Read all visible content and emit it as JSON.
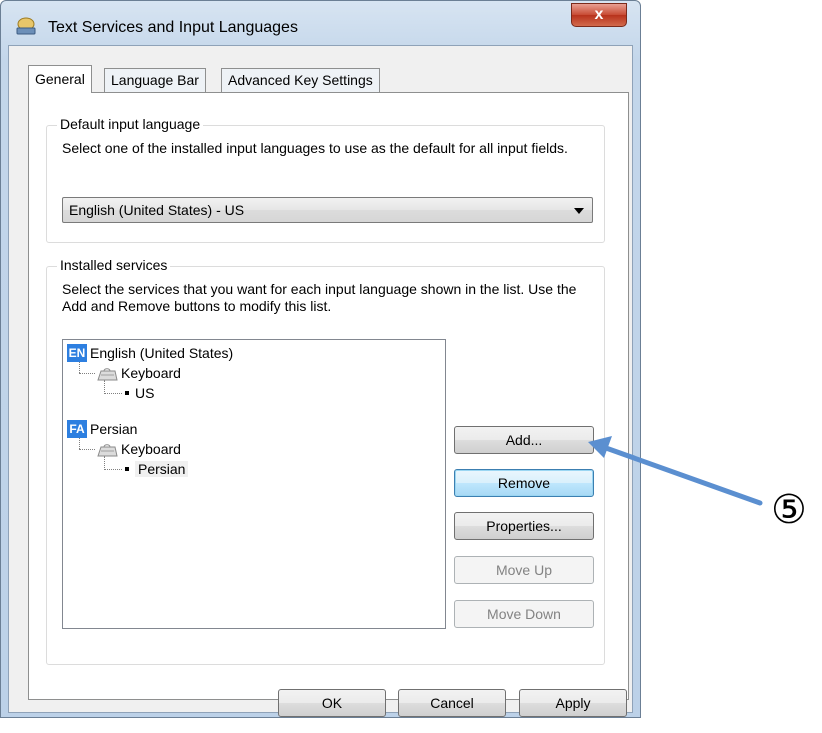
{
  "window": {
    "title": "Text Services and Input Languages",
    "close_glyph": "x"
  },
  "tabs": [
    {
      "label": "General",
      "active": true
    },
    {
      "label": "Language Bar",
      "active": false
    },
    {
      "label": "Advanced Key Settings",
      "active": false
    }
  ],
  "default_input": {
    "legend": "Default input language",
    "description": "Select one of the installed input languages to use as the default for all input fields.",
    "selected": "English (United States) - US"
  },
  "installed_services": {
    "legend": "Installed services",
    "description": "Select the services that you want for each input language shown in the list. Use the Add and Remove buttons to modify this list.",
    "tree": [
      {
        "badge": "EN",
        "language": "English (United States)",
        "category": "Keyboard",
        "layout": "US"
      },
      {
        "badge": "FA",
        "language": "Persian",
        "category": "Keyboard",
        "layout": "Persian"
      }
    ],
    "buttons": {
      "add": "Add...",
      "remove": "Remove",
      "properties": "Properties...",
      "move_up": "Move Up",
      "move_down": "Move Down"
    }
  },
  "footer": {
    "ok": "OK",
    "cancel": "Cancel",
    "apply": "Apply"
  },
  "annotation": {
    "marker": "⑤",
    "arrow_color": "#5b8fd0"
  }
}
